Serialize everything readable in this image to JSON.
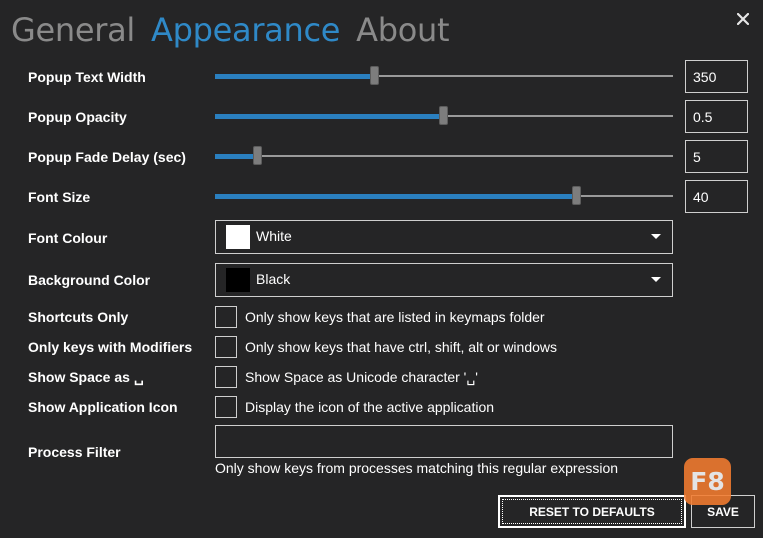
{
  "tabs": [
    {
      "label": "General",
      "active": false
    },
    {
      "label": "Appearance",
      "active": true
    },
    {
      "label": "About",
      "active": false
    }
  ],
  "close_icon": "close-icon",
  "sliders": [
    {
      "label": "Popup Text Width",
      "value": "350",
      "fraction": 0.35
    },
    {
      "label": "Popup Opacity",
      "value": "0.5",
      "fraction": 0.5
    },
    {
      "label": "Popup Fade Delay (sec)",
      "value": "5",
      "fraction": 0.094
    },
    {
      "label": "Font Size",
      "value": "40",
      "fraction": 0.79
    }
  ],
  "font_colour": {
    "label": "Font Colour",
    "value": "White",
    "swatch": "#ffffff"
  },
  "background_color": {
    "label": "Background Color",
    "value": "Black",
    "swatch": "#000000"
  },
  "checkboxes": [
    {
      "label": "Shortcuts Only",
      "text": "Only show keys that are listed in keymaps folder",
      "checked": false
    },
    {
      "label": "Only keys with Modifiers",
      "text": "Only show keys that have ctrl, shift, alt or windows",
      "checked": false
    },
    {
      "label": "Show Space as ␣",
      "text": "Show Space as Unicode character '␣'",
      "checked": false
    },
    {
      "label": "Show Application Icon",
      "text": "Display the icon of the active application",
      "checked": false
    }
  ],
  "process_filter": {
    "label": "Process Filter",
    "value": "",
    "hint": "Only show keys from processes matching this regular expression"
  },
  "buttons": {
    "reset": "RESET TO DEFAULTS",
    "save": "SAVE"
  },
  "badge": {
    "text": "F8"
  },
  "colors": {
    "background": "#252526",
    "accent": "#2f89c7",
    "slider_fill": "#2a7fbf",
    "inactive_tab": "#8a8a8a",
    "badge": "#f47c30"
  }
}
